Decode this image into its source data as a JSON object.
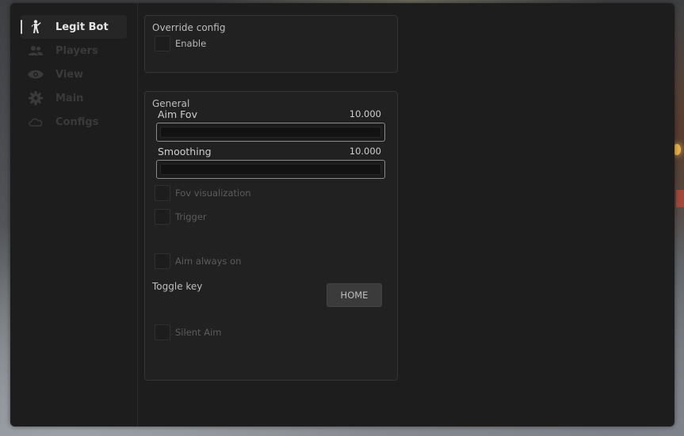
{
  "sidebar": {
    "items": [
      {
        "label": "Legit Bot",
        "icon": "person-icon",
        "active": true
      },
      {
        "label": "Players",
        "icon": "users-icon",
        "active": false
      },
      {
        "label": "View",
        "icon": "eye-icon",
        "active": false
      },
      {
        "label": "Main",
        "icon": "gear-icon",
        "active": false
      },
      {
        "label": "Configs",
        "icon": "cloud-icon",
        "active": false
      }
    ]
  },
  "override_panel": {
    "title": "Override config",
    "enable_label": "Enable"
  },
  "general_panel": {
    "title": "General",
    "aim_fov": {
      "label": "Aim Fov",
      "value": "10.000"
    },
    "smoothing": {
      "label": "Smoothing",
      "value": "10.000"
    },
    "fov_visualization_label": "Fov visualization",
    "trigger_label": "Trigger",
    "aim_always_on_label": "Aim always on",
    "toggle_key_label": "Toggle key",
    "toggle_key_value": "HOME",
    "silent_aim_label": "Silent Aim"
  },
  "colors": {
    "window_bg": "#1d1d1d",
    "panel_bg": "#212121",
    "accent_text": "#e4e4e4"
  }
}
